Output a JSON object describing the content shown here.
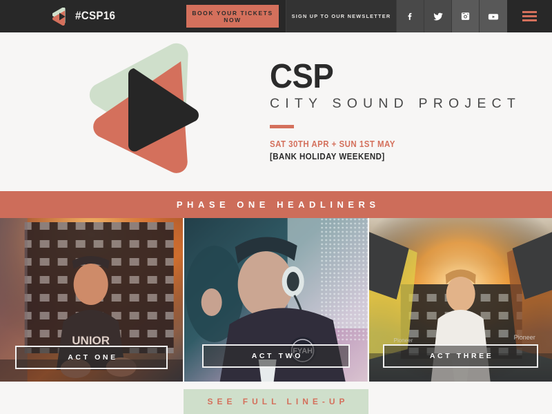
{
  "topbar": {
    "logo_icon": "csp-play-logo-icon",
    "brand": "#CSP16",
    "tickets_label": "BOOK YOUR TICKETS NOW",
    "newsletter_label": "SIGN UP TO OUR NEWSLETTER",
    "social": [
      {
        "name": "facebook-icon",
        "label": "f"
      },
      {
        "name": "twitter-icon",
        "label": ""
      },
      {
        "name": "instagram-icon",
        "label": ""
      },
      {
        "name": "youtube-icon",
        "label": ""
      }
    ],
    "menu_icon": "hamburger-menu-icon"
  },
  "hero": {
    "logo_icon": "csp-play-triangle-logo-icon",
    "title": "CSP",
    "subtitle": "CITY SOUND PROJECT",
    "date": "SAT 30TH APR + SUN 1ST MAY",
    "note": "[BANK HOLIDAY WEEKEND]"
  },
  "phase_banner": {
    "label": "PHASE ONE HEADLINERS"
  },
  "acts": [
    {
      "label": "ACT ONE"
    },
    {
      "label": "ACT TWO"
    },
    {
      "label": "ACT THREE"
    }
  ],
  "cta": {
    "lineup_label": "SEE FULL LINE-UP"
  },
  "colors": {
    "accent_salmon": "#d4705c",
    "banner_salmon": "#cd6d5a",
    "pale_green": "#cfdfcb",
    "dark_bar": "#282828",
    "page_bg": "#f7f6f5"
  }
}
